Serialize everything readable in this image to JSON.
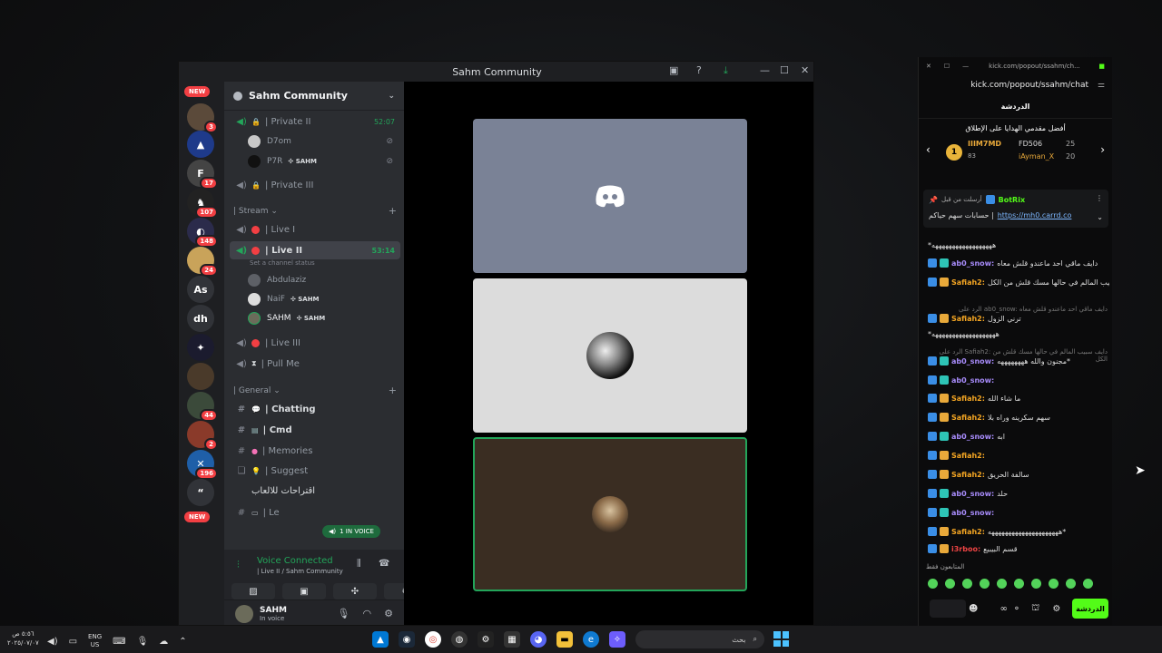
{
  "discord": {
    "window_title": "Sahm Community",
    "server_name": "Sahm Community",
    "server_rail": {
      "new_label": "NEW",
      "badges": [
        "3",
        "17",
        "107",
        "148",
        "24",
        "44",
        "2",
        "196"
      ],
      "text_icons": [
        "As",
        "dh"
      ]
    },
    "voice_channels": [
      {
        "name": "| Private II",
        "timer": "52:07"
      },
      {
        "name": "| Private III"
      }
    ],
    "private_users": [
      {
        "name": "D7om"
      },
      {
        "name": "P7R",
        "tag": "✣ SAHM"
      }
    ],
    "stream_category": "| Stream",
    "stream_channels": [
      {
        "name": "| Live I"
      },
      {
        "name": "| Live II",
        "timer": "53:14",
        "status": "Set a channel status"
      },
      {
        "name": "| Live III"
      },
      {
        "name": "| Pull Me"
      }
    ],
    "live_users": [
      {
        "name": "Abdulaziz"
      },
      {
        "name": "NaiF",
        "tag": "✣ SAHM"
      },
      {
        "name": "SAHM",
        "tag": "✣ SAHM"
      }
    ],
    "general_category": "| General",
    "text_channels": [
      {
        "name": "| Chatting"
      },
      {
        "name": "| Cmd"
      },
      {
        "name": "| Memories"
      },
      {
        "name": "| Suggest"
      },
      {
        "name": "اقتراحات للالعاب"
      },
      {
        "name": "| Le"
      }
    ],
    "in_voice_pill": "1 IN VOICE",
    "voice_panel": {
      "title": "Voice Connected",
      "subtitle": "| Live II / Sahm Community"
    },
    "user_panel": {
      "name": "SAHM",
      "status": "In voice"
    },
    "colors": {
      "accent_green": "#23a55a",
      "live_red": "#f23f43",
      "lock": "#e6a23c"
    }
  },
  "kick": {
    "url_short": "kick.com/popout/ssahm/ch...",
    "url": "kick.com/popout/ssahm/chat",
    "chat_title": "الدردشة",
    "leaderboard_title": "أفضل مقدمي الهدايا على الإطلاق",
    "leaders": [
      {
        "rank": "1",
        "name": "IIIM7MD",
        "score": "83"
      },
      {
        "name": "FD506",
        "score": "25"
      },
      {
        "name": "iAyman_X",
        "score": "20"
      }
    ],
    "pinned": {
      "pinned_by": "أرسلت من قبل",
      "bot": "BotRix",
      "text": "حسابات سهم حياكم |",
      "link": "https://mh0.carrd.co"
    },
    "messages": [
      {
        "user": "",
        "text": "*ههههههههههههههههههه"
      },
      {
        "user": "ab0_snow:",
        "text": "دايف ماقي احد ماعندو قلش معاه"
      },
      {
        "user": "Safiah2:",
        "text": "دايف سبيب المالم في حالها مسك قلش من الكل"
      },
      {
        "user": "Safiah2:",
        "text": "ترني الزول",
        "reply": "الرد على ab0_snow: دايف ماقي احد ماعندو قلش معاه"
      },
      {
        "user": "",
        "text": "*هههههههههههههههههههه"
      },
      {
        "user": "ab0_snow:",
        "text": "مجنون والله ههههههههه*",
        "reply": "الرد على Safiah2: دايف سبيب المالم في حالها مسك قلش من الكل"
      },
      {
        "user": "ab0_snow:",
        "text": ""
      },
      {
        "user": "Safiah2:",
        "text": "ما شاء الله"
      },
      {
        "user": "Safiah2:",
        "text": "سهم سكرينه وراه بلا"
      },
      {
        "user": "ab0_snow:",
        "text": "ابه"
      },
      {
        "user": "Safiah2:",
        "text": ""
      },
      {
        "user": "Safiah2:",
        "text": "سالفة الحريق"
      },
      {
        "user": "ab0_snow:",
        "text": "حلد"
      },
      {
        "user": "ab0_snow:",
        "text": ""
      },
      {
        "user": "Safiah2:",
        "text": "هههههههههههههههههههههه*"
      },
      {
        "user": "i3rboo:",
        "text": "قسم البيبيع"
      }
    ],
    "subs_only": "المتابعون فقط",
    "chat_button": "الدردشة",
    "colors": {
      "kick_green": "#53fc18",
      "snow": "#a78bfa",
      "safiah": "#f5a623",
      "rboo": "#ef4444"
    }
  },
  "taskbar": {
    "time": "٥:٥٦ ص",
    "date": "٢٠٢٥/٠٧/٠٧",
    "lang": "ENG",
    "region": "US",
    "search_placeholder": "بحث"
  }
}
